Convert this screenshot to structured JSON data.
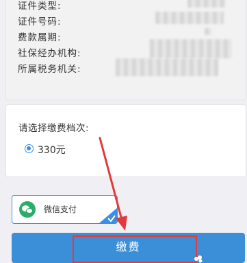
{
  "info": {
    "rows": [
      {
        "label": "证件类型:"
      },
      {
        "label": "证件号码:"
      },
      {
        "label": "费款属期:"
      },
      {
        "label": "社保经办机构:"
      },
      {
        "label": "所属税务机关:"
      }
    ]
  },
  "tier": {
    "title": "请选择缴费档次:",
    "options": [
      {
        "label": "330元",
        "selected": true
      }
    ]
  },
  "payment_method": {
    "label": "微信支付",
    "icon": "wechat-icon",
    "selected": true
  },
  "pay_button": {
    "label": "缴费"
  },
  "colors": {
    "accent": "#3a8fd8",
    "annotation": "#e23a3a",
    "wechat": "#2aae67"
  }
}
